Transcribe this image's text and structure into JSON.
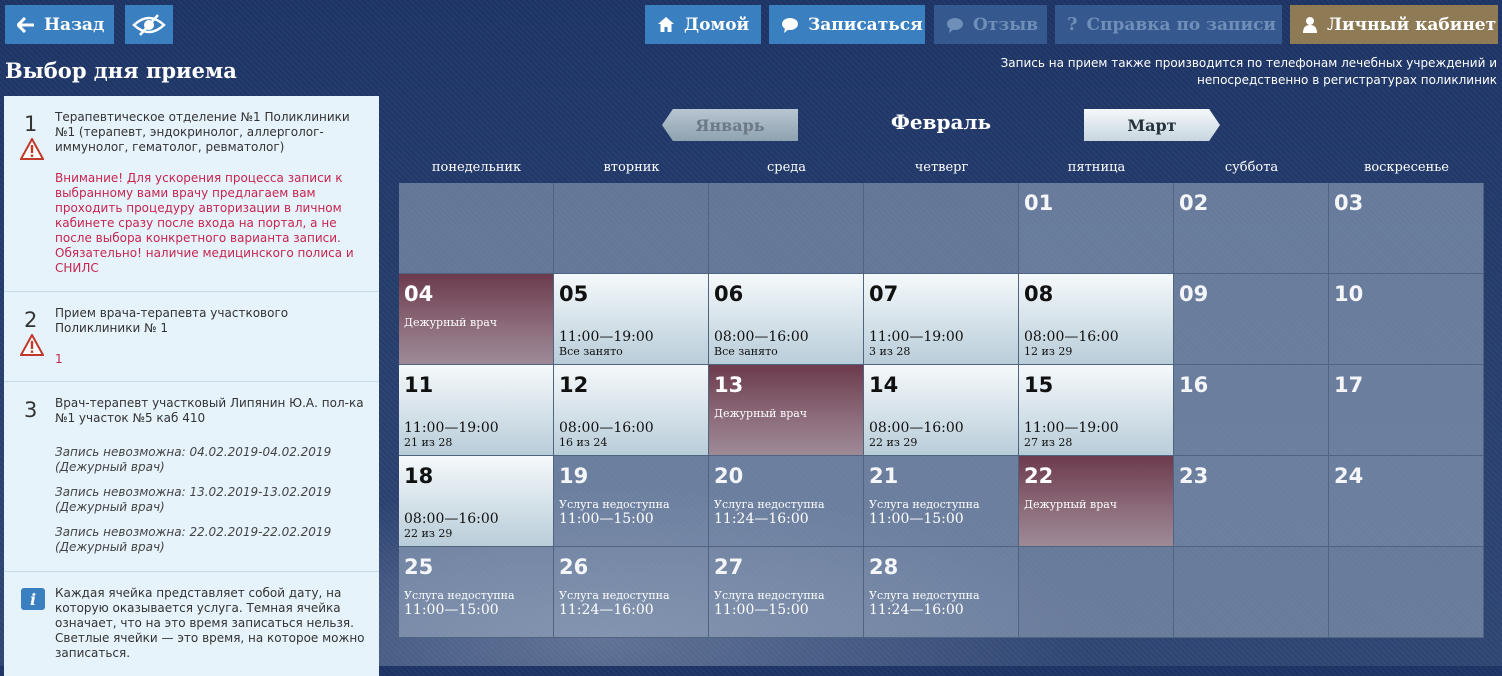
{
  "toolbar": {
    "back_label": "Назад",
    "home_label": "Домой",
    "signup_label": "Записаться",
    "review_label": "Отзыв",
    "help_label": "Справка по записи",
    "cabinet_label": "Личный кабинет",
    "icons": [
      "arrow-left-icon",
      "eye-crossed-icon",
      "home-icon",
      "speech-bubble-icon",
      "question-icon",
      "user-icon"
    ]
  },
  "page_title": "Выбор дня приема",
  "phone_note": "Запись на прием также производится по телефонам лечебных учреждений и непосредственно в регистратурах поликлиник",
  "steps": [
    {
      "num": "1",
      "title": "Терапевтическое отделение №1 Поликлиники №1 (терапевт, эндокринолог, аллерголог-иммунолог, гематолог, ревматолог)",
      "alert": "Внимание! Для ускорения процесса записи к выбранному вами врачу предлагаем вам проходить процедуру авторизации в личном кабинете сразу после входа на портал, а не после выбора конкретного варианта записи. Обязательно! наличие медицинского полиса и СНИЛС"
    },
    {
      "num": "2",
      "title": "Прием врача-терапевта участкового Поликлиники № 1",
      "alert": "1"
    },
    {
      "num": "3",
      "title": "Врач-терапевт участковый Липянин Ю.А. пол-ка №1 участок №5 каб 410",
      "unavailable": [
        "Запись невозможна: 04.02.2019-04.02.2019 (Дежурный врач)",
        "Запись невозможна: 13.02.2019-13.02.2019 (Дежурный врач)",
        "Запись невозможна: 22.02.2019-22.02.2019 (Дежурный врач)"
      ]
    }
  ],
  "info_text": "Каждая ячейка представляет собой дату, на которую оказывается услуга. Темная ячейка означает, что на это время записаться нельзя. Светлые ячейки — это время, на которое можно записаться.",
  "calendar": {
    "prev_month": "Январь",
    "current_month": "Февраль",
    "next_month": "Март",
    "weekdays": [
      "понедельник",
      "вторник",
      "среда",
      "четверг",
      "пятница",
      "суббота",
      "воскресенье"
    ],
    "cells": [
      {
        "type": "empty"
      },
      {
        "type": "empty"
      },
      {
        "type": "empty"
      },
      {
        "type": "empty"
      },
      {
        "day": "01",
        "type": "weekend"
      },
      {
        "day": "02",
        "type": "weekend"
      },
      {
        "day": "03",
        "type": "weekend"
      },
      {
        "day": "04",
        "type": "duty",
        "sub": "Дежурный врач"
      },
      {
        "day": "05",
        "type": "light",
        "time": "11:00—19:00",
        "sub": "Все занято"
      },
      {
        "day": "06",
        "type": "light",
        "time": "08:00—16:00",
        "sub": "Все занято"
      },
      {
        "day": "07",
        "type": "light",
        "time": "11:00—19:00",
        "sub": "3 из 28"
      },
      {
        "day": "08",
        "type": "light",
        "time": "08:00—16:00",
        "sub": "12 из 29"
      },
      {
        "day": "09",
        "type": "weekend"
      },
      {
        "day": "10",
        "type": "weekend"
      },
      {
        "day": "11",
        "type": "light",
        "time": "11:00—19:00",
        "sub": "21 из 28"
      },
      {
        "day": "12",
        "type": "light",
        "time": "08:00—16:00",
        "sub": "16 из 24"
      },
      {
        "day": "13",
        "type": "duty",
        "sub": "Дежурный врач"
      },
      {
        "day": "14",
        "type": "light",
        "time": "08:00—16:00",
        "sub": "22 из 29"
      },
      {
        "day": "15",
        "type": "light",
        "time": "11:00—19:00",
        "sub": "27 из 28"
      },
      {
        "day": "16",
        "type": "weekend"
      },
      {
        "day": "17",
        "type": "weekend"
      },
      {
        "day": "18",
        "type": "light",
        "time": "08:00—16:00",
        "sub": "22 из 29"
      },
      {
        "day": "19",
        "type": "unavail",
        "sub": "Услуга недоступна",
        "time": "11:00—15:00"
      },
      {
        "day": "20",
        "type": "unavail",
        "sub": "Услуга недоступна",
        "time": "11:24—16:00"
      },
      {
        "day": "21",
        "type": "unavail",
        "sub": "Услуга недоступна",
        "time": "11:00—15:00"
      },
      {
        "day": "22",
        "type": "duty",
        "sub": "Дежурный врач"
      },
      {
        "day": "23",
        "type": "weekend"
      },
      {
        "day": "24",
        "type": "weekend"
      },
      {
        "day": "25",
        "type": "unavail",
        "sub": "Услуга недоступна",
        "time": "11:00—15:00"
      },
      {
        "day": "26",
        "type": "unavail",
        "sub": "Услуга недоступна",
        "time": "11:24—16:00"
      },
      {
        "day": "27",
        "type": "unavail",
        "sub": "Услуга недоступна",
        "time": "11:00—15:00"
      },
      {
        "day": "28",
        "type": "unavail",
        "sub": "Услуга недоступна",
        "time": "11:24—16:00"
      },
      {
        "type": "empty"
      },
      {
        "type": "empty"
      },
      {
        "type": "empty"
      }
    ]
  },
  "colors": {
    "button_blue": "#3a7fbf",
    "button_disabled": "#35588f",
    "button_brown": "#8e7a55",
    "alert_red": "#c7254e",
    "duty_cell": "#6c3b4d"
  }
}
